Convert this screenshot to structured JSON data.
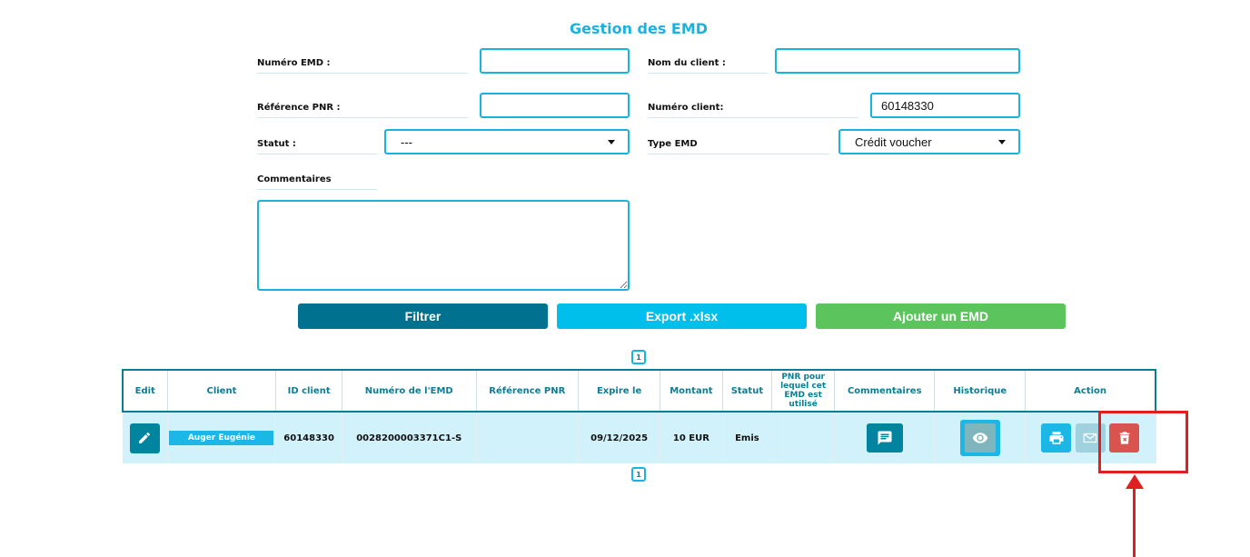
{
  "page": {
    "title": "Gestion des EMD"
  },
  "form": {
    "numero_emd": {
      "label": "Numéro EMD :",
      "value": ""
    },
    "nom_client": {
      "label": "Nom du client :",
      "value": ""
    },
    "reference_pnr": {
      "label": "Référence PNR :",
      "value": ""
    },
    "numero_client": {
      "label": "Numéro client:",
      "value": "60148330"
    },
    "statut": {
      "label": "Statut :",
      "selected": "---"
    },
    "type_emd": {
      "label": "Type EMD",
      "selected": "Crédit voucher"
    },
    "commentaires": {
      "label": "Commentaires",
      "value": ""
    }
  },
  "buttons": {
    "filtrer": "Filtrer",
    "export": "Export .xlsx",
    "ajouter": "Ajouter un EMD"
  },
  "colors": {
    "filtrer": "#00718e",
    "export": "#00bfea",
    "ajouter": "#5cc45c",
    "accent": "#17b4dc"
  },
  "pagination": {
    "top_page": "1",
    "bottom_page": "1"
  },
  "table": {
    "headers": {
      "edit": "Edit",
      "client": "Client",
      "id_client": "ID client",
      "numero_emd": "Numéro de l'EMD",
      "reference_pnr": "Référence PNR",
      "expire_le": "Expire le",
      "montant": "Montant",
      "statut": "Statut",
      "pnr_utilise": "PNR pour lequel cet EMD est utilisé",
      "commentaires": "Commentaires",
      "historique": "Historique",
      "action": "Action"
    },
    "rows": [
      {
        "client": "Auger Eugénie",
        "id_client": "60148330",
        "numero_emd": "0028200003371C1-S",
        "reference_pnr": "",
        "expire_le": "09/12/2025",
        "montant": "10 EUR",
        "statut": "Emis",
        "pnr_utilise": ""
      }
    ]
  },
  "icons": {
    "edit": "pencil-icon",
    "comment": "comment-icon",
    "history": "eye-icon",
    "print": "printer-icon",
    "mail": "envelope-icon",
    "delete": "trash-icon"
  }
}
